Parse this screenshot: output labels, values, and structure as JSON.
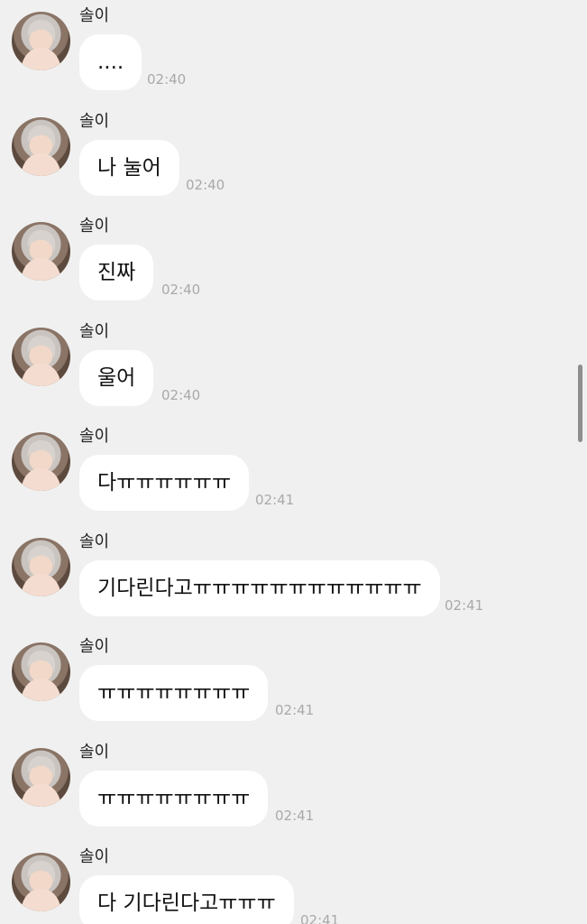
{
  "messages": [
    {
      "sender": "솔이",
      "text": "....",
      "time": "02:40"
    },
    {
      "sender": "솔이",
      "text": "나 눌어",
      "time": "02:40"
    },
    {
      "sender": "솔이",
      "text": "진짜",
      "time": "02:40"
    },
    {
      "sender": "솔이",
      "text": "울어",
      "time": "02:40"
    },
    {
      "sender": "솔이",
      "text": "다ㅠㅠㅠㅠㅠㅠ",
      "time": "02:41"
    },
    {
      "sender": "솔이",
      "text": "기다린다고ㅠㅠㅠㅠㅠㅠㅠㅠㅠㅠㅠㅠ",
      "time": "02:41"
    },
    {
      "sender": "솔이",
      "text": "ㅠㅠㅠㅠㅠㅠㅠㅠ",
      "time": "02:41"
    },
    {
      "sender": "솔이",
      "text": "ㅠㅠㅠㅠㅠㅠㅠㅠ",
      "time": "02:41"
    },
    {
      "sender": "솔이",
      "text": "다 기다린다고ㅠㅠㅠ",
      "time": "02:41"
    }
  ],
  "colors": {
    "background": "#f0f0f0",
    "bubble": "#ffffff",
    "timestamp": "#a9a9a9"
  },
  "icons": {
    "avatar": "profile-photo"
  }
}
